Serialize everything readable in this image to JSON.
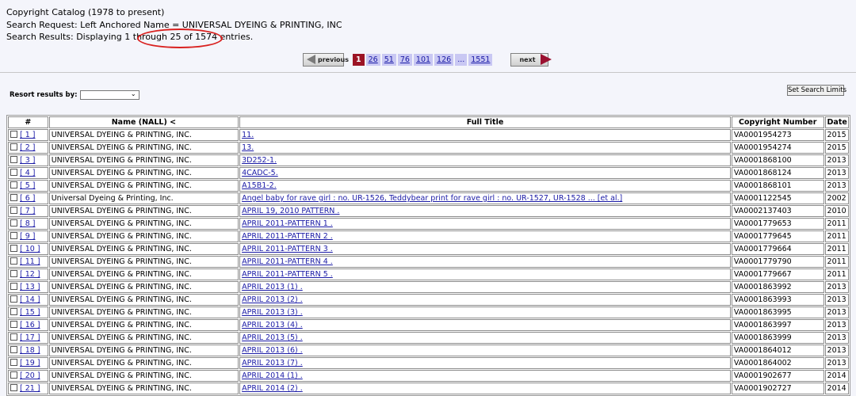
{
  "header": {
    "line1": "Copyright Catalog (1978 to present)",
    "line2": "Search Request: Left Anchored Name = UNIVERSAL DYEING & PRINTING, INC",
    "line3": "Search Results: Displaying 1 through 25 of 1574 entries."
  },
  "pagination": {
    "previous_label": "previous",
    "next_label": "next",
    "current": "1",
    "pages": [
      "26",
      "51",
      "76",
      "101",
      "126",
      "...",
      "1551"
    ]
  },
  "resort": {
    "label": "Resort results by:",
    "value": ""
  },
  "limits_button": "Set Search Limits",
  "table": {
    "headers": [
      "#",
      "Name (NALL) <",
      "Full Title",
      "Copyright Number",
      "Date"
    ],
    "rows": [
      {
        "num": "[ 1 ]",
        "name": "UNIVERSAL DYEING & PRINTING, INC.",
        "title": "11.",
        "reg": "VA0001954273",
        "date": "2015"
      },
      {
        "num": "[ 2 ]",
        "name": "UNIVERSAL DYEING & PRINTING, INC.",
        "title": "13.",
        "reg": "VA0001954274",
        "date": "2015"
      },
      {
        "num": "[ 3 ]",
        "name": "UNIVERSAL DYEING & PRINTING, INC.",
        "title": "3D252-1.",
        "reg": "VA0001868100",
        "date": "2013"
      },
      {
        "num": "[ 4 ]",
        "name": "UNIVERSAL DYEING & PRINTING, INC.",
        "title": "4CADC-5.",
        "reg": "VA0001868124",
        "date": "2013"
      },
      {
        "num": "[ 5 ]",
        "name": "UNIVERSAL DYEING & PRINTING, INC.",
        "title": "A15B1-2.",
        "reg": "VA0001868101",
        "date": "2013"
      },
      {
        "num": "[ 6 ]",
        "name": "Universal Dyeing & Printing, Inc.",
        "title": "Angel baby for rave girl : no. UR-1526, Teddybear print for rave girl : no. UR-1527, UR-1528 ... [et al.]",
        "reg": "VA0001122545",
        "date": "2002"
      },
      {
        "num": "[ 7 ]",
        "name": "UNIVERSAL DYEING & PRINTING, INC.",
        "title": "APRIL 19, 2010 PATTERN .",
        "reg": "VA0002137403",
        "date": "2010"
      },
      {
        "num": "[ 8 ]",
        "name": "UNIVERSAL DYEING & PRINTING, INC.",
        "title": "APRIL 2011-PATTERN 1 .",
        "reg": "VA0001779653",
        "date": "2011"
      },
      {
        "num": "[ 9 ]",
        "name": "UNIVERSAL DYEING & PRINTING, INC.",
        "title": "APRIL 2011-PATTERN 2 .",
        "reg": "VA0001779645",
        "date": "2011"
      },
      {
        "num": "[ 10 ]",
        "name": "UNIVERSAL DYEING & PRINTING, INC.",
        "title": "APRIL 2011-PATTERN 3 .",
        "reg": "VA0001779664",
        "date": "2011"
      },
      {
        "num": "[ 11 ]",
        "name": "UNIVERSAL DYEING & PRINTING, INC.",
        "title": "APRIL 2011-PATTERN 4 .",
        "reg": "VA0001779790",
        "date": "2011"
      },
      {
        "num": "[ 12 ]",
        "name": "UNIVERSAL DYEING & PRINTING, INC.",
        "title": "APRIL 2011-PATTERN 5 .",
        "reg": "VA0001779667",
        "date": "2011"
      },
      {
        "num": "[ 13 ]",
        "name": "UNIVERSAL DYEING & PRINTING, INC.",
        "title": "APRIL 2013 (1) .",
        "reg": "VA0001863992",
        "date": "2013"
      },
      {
        "num": "[ 14 ]",
        "name": "UNIVERSAL DYEING & PRINTING, INC.",
        "title": "APRIL 2013 (2) .",
        "reg": "VA0001863993",
        "date": "2013"
      },
      {
        "num": "[ 15 ]",
        "name": "UNIVERSAL DYEING & PRINTING, INC.",
        "title": "APRIL 2013 (3) .",
        "reg": "VA0001863995",
        "date": "2013"
      },
      {
        "num": "[ 16 ]",
        "name": "UNIVERSAL DYEING & PRINTING, INC.",
        "title": "APRIL 2013 (4) .",
        "reg": "VA0001863997",
        "date": "2013"
      },
      {
        "num": "[ 17 ]",
        "name": "UNIVERSAL DYEING & PRINTING, INC.",
        "title": "APRIL 2013 (5) .",
        "reg": "VA0001863999",
        "date": "2013"
      },
      {
        "num": "[ 18 ]",
        "name": "UNIVERSAL DYEING & PRINTING, INC.",
        "title": "APRIL 2013 (6) .",
        "reg": "VA0001864012",
        "date": "2013"
      },
      {
        "num": "[ 19 ]",
        "name": "UNIVERSAL DYEING & PRINTING, INC.",
        "title": "APRIL 2013 (7) .",
        "reg": "VA0001864002",
        "date": "2013"
      },
      {
        "num": "[ 20 ]",
        "name": "UNIVERSAL DYEING & PRINTING, INC.",
        "title": "APRIL 2014 (1) .",
        "reg": "VA0001902677",
        "date": "2014"
      },
      {
        "num": "[ 21 ]",
        "name": "UNIVERSAL DYEING & PRINTING, INC.",
        "title": "APRIL 2014 (2) .",
        "reg": "VA0001902727",
        "date": "2014"
      }
    ]
  }
}
